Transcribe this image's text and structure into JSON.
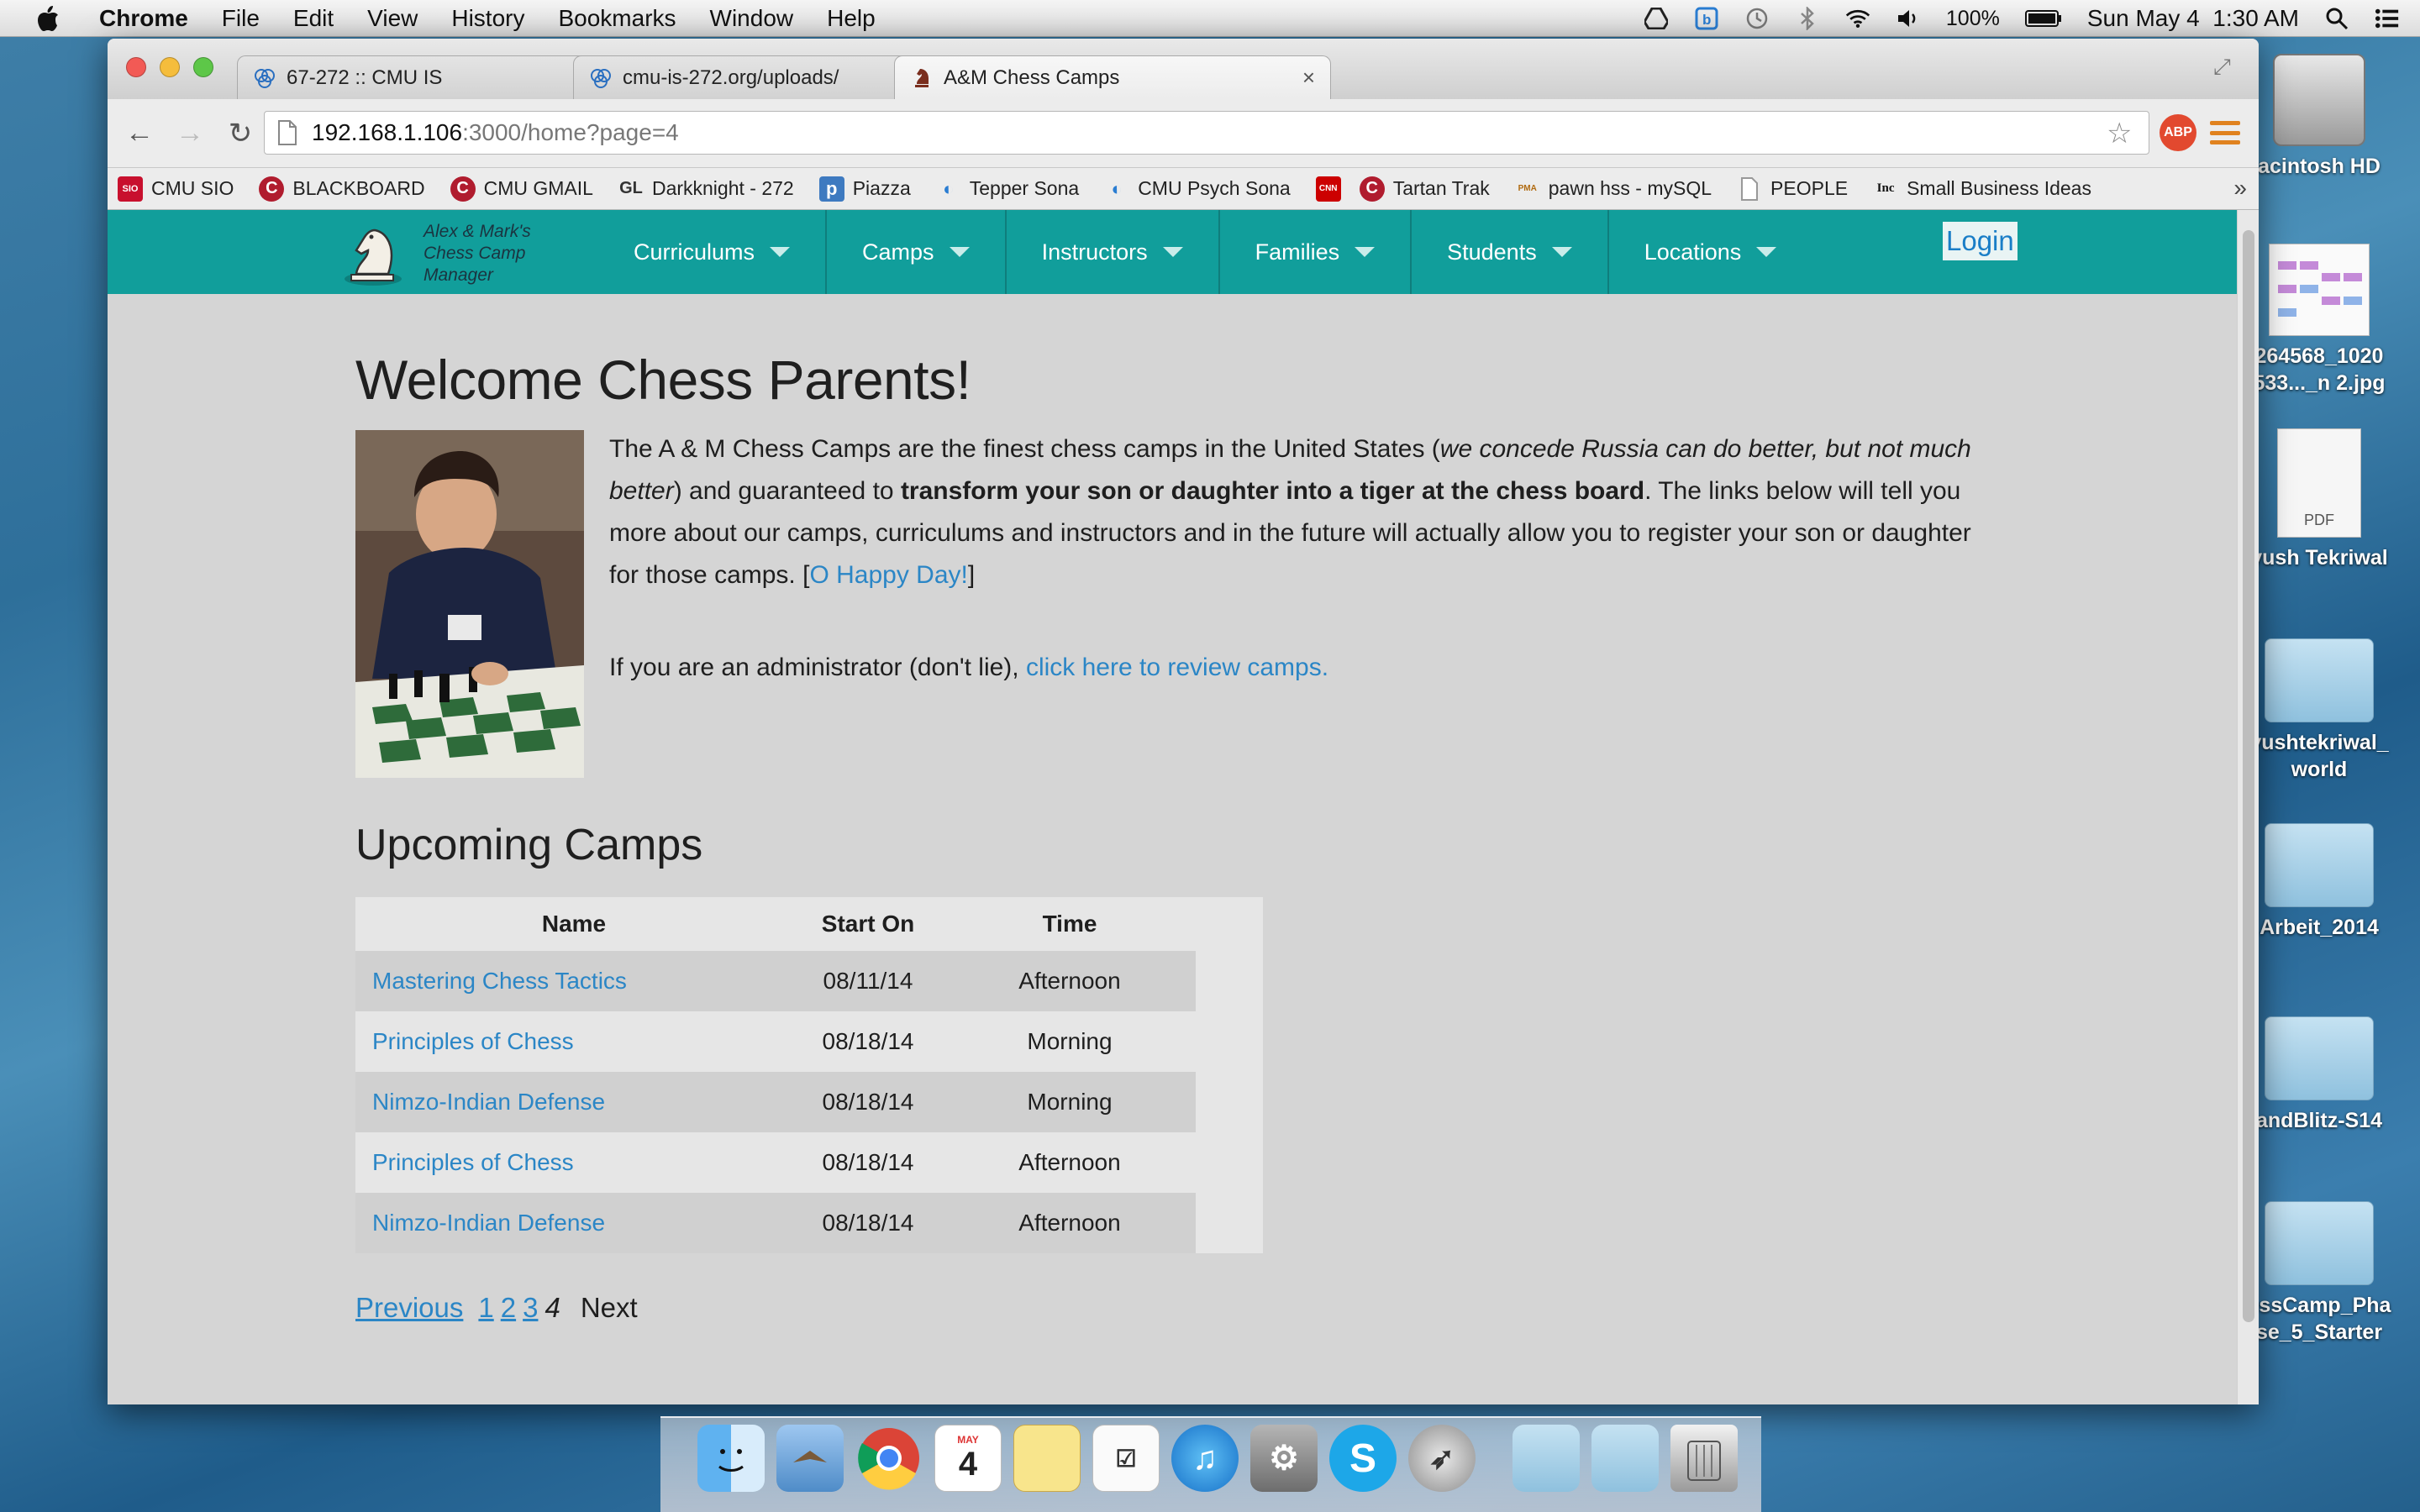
{
  "menubar": {
    "app_name": "Chrome",
    "items": [
      "File",
      "Edit",
      "View",
      "History",
      "Bookmarks",
      "Window",
      "Help"
    ],
    "battery": "100%",
    "clock": "Sun May 4  1:30 AM"
  },
  "browser": {
    "tabs": [
      {
        "title": "67-272 :: CMU IS"
      },
      {
        "title": "cmu-is-272.org/uploads/"
      },
      {
        "title": "A&M Chess Camps"
      }
    ],
    "url_host": "192.168.1.106",
    "url_path": ":3000/home?page=4",
    "abp_label": "ABP",
    "bookmarks": [
      {
        "label": "CMU SIO",
        "icon": "SIO",
        "color": "#c8102e"
      },
      {
        "label": "BLACKBOARD",
        "icon": "C",
        "color": "#b01c2e"
      },
      {
        "label": "CMU GMAIL",
        "icon": "C",
        "color": "#b01c2e"
      },
      {
        "label": "Darkknight - 272",
        "icon": "GL",
        "color": "#ececec"
      },
      {
        "label": "Piazza",
        "icon": "p",
        "color": "#3e7ac0"
      },
      {
        "label": "Tepper Sona",
        "icon": "◐",
        "color": "#f2f2f2"
      },
      {
        "label": "CMU Psych Sona",
        "icon": "◐",
        "color": "#f2f2f2"
      },
      {
        "label": "",
        "icon": "CNN",
        "color": "#cc0000"
      },
      {
        "label": "Tartan Trak",
        "icon": "C",
        "color": "#b01c2e"
      },
      {
        "label": "pawn hss - mySQL",
        "icon": "PMA",
        "color": "#f2f2f2"
      },
      {
        "label": "PEOPLE",
        "icon": "",
        "color": "#f7f7f7"
      },
      {
        "label": "Small Business Ideas",
        "icon": "Inc",
        "color": "#ffffff"
      }
    ],
    "bookmarks_more": "»"
  },
  "site": {
    "logo_text": [
      "Alex & Mark's",
      "Chess Camp",
      "Manager"
    ],
    "nav": [
      "Curriculums",
      "Camps",
      "Instructors",
      "Families",
      "Students",
      "Locations"
    ],
    "login": "Login",
    "welcome_title": "Welcome Chess Parents!",
    "intro": {
      "p1_start": "The A & M Chess Camps are the finest chess camps in the United States (",
      "p1_italic": "we concede Russia can do better, but not much better",
      "p1_mid": ") and guaranteed to ",
      "p1_bold": "transform your son or daughter into a tiger at the chess board",
      "p1_end": ". The links below will tell you more about our camps, curriculums and instructors and in the future will actually allow you to register your son or daughter for those camps. [",
      "p1_link": "O Happy Day!",
      "p1_close": "]"
    },
    "admin": {
      "text": "If you are an administrator (don't lie), ",
      "link": "click here to review camps."
    },
    "upcoming_title": "Upcoming Camps",
    "table": {
      "headers": [
        "Name",
        "Start On",
        "Time"
      ],
      "rows": [
        {
          "name": "Mastering Chess Tactics",
          "start": "08/11/14",
          "time": "Afternoon"
        },
        {
          "name": "Principles of Chess",
          "start": "08/18/14",
          "time": "Morning"
        },
        {
          "name": "Nimzo-Indian Defense",
          "start": "08/18/14",
          "time": "Morning"
        },
        {
          "name": "Principles of Chess",
          "start": "08/18/14",
          "time": "Afternoon"
        },
        {
          "name": "Nimzo-Indian Defense",
          "start": "08/18/14",
          "time": "Afternoon"
        }
      ]
    },
    "pager": {
      "previous": "Previous",
      "pages": [
        "1",
        "2",
        "3",
        "4"
      ],
      "current": "4",
      "next": "Next"
    }
  },
  "desktop": {
    "icons": [
      {
        "label": "acintosh HD"
      },
      {
        "label": "264568_1020\n533..._n 2.jpg"
      },
      {
        "label": "yush Tekriwal"
      },
      {
        "label": "yushtekriwal_\nworld"
      },
      {
        "label": "Arbeit_2014"
      },
      {
        "label": "andBlitz-S14"
      },
      {
        "label": "essCamp_Pha\nse_5_Starter"
      }
    ],
    "pdf_badge": "PDF"
  },
  "dock": {
    "calendar_day": "4",
    "calendar_month": "MAY"
  }
}
